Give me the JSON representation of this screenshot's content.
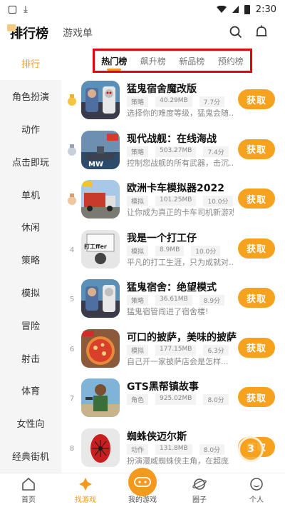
{
  "status": {
    "time": "2:30"
  },
  "header": {
    "title": "排行榜",
    "sub": "游戏单"
  },
  "sidebar": {
    "items": [
      {
        "label": "排行"
      },
      {
        "label": "角色扮演"
      },
      {
        "label": "动作"
      },
      {
        "label": "点击即玩"
      },
      {
        "label": "单机"
      },
      {
        "label": "休闲"
      },
      {
        "label": "策略"
      },
      {
        "label": "模拟"
      },
      {
        "label": "冒险"
      },
      {
        "label": "射击"
      },
      {
        "label": "体育"
      },
      {
        "label": "女性向"
      },
      {
        "label": "经典街机"
      }
    ]
  },
  "tabs": [
    {
      "label": "热门榜"
    },
    {
      "label": "飙升榜"
    },
    {
      "label": "新品榜"
    },
    {
      "label": "预约榜"
    }
  ],
  "games": [
    {
      "rank": "1",
      "name": "猛鬼宿舍魔改版",
      "genre": "策略",
      "size": "40.29MB",
      "score": "7.7分",
      "desc": "选择你的难度等级，猛鬼会随..."
    },
    {
      "rank": "2",
      "name": "现代战舰：在线海战",
      "genre": "策略",
      "size": "503.27MB",
      "score": "7.4分",
      "desc": "控制您战舰的所有武器，击沉..."
    },
    {
      "rank": "3",
      "name": "欧洲卡车模拟器2022",
      "genre": "模拟",
      "size": "101.25MB",
      "score": "10.0分",
      "desc": "让你成为真正的卡车司机新游戏"
    },
    {
      "rank": "4",
      "name": "我是一个打工仔",
      "genre": "模拟",
      "size": "8.9MB",
      "score": "10.0分",
      "desc": "平凡的打工生涯，只为成就对..."
    },
    {
      "rank": "5",
      "name": "猛鬼宿舍：绝望模式",
      "genre": "策略",
      "size": "36.61MB",
      "score": "8.9分",
      "desc": "猛鬼宿管闯进了宿舍楼!"
    },
    {
      "rank": "6",
      "name": "可口的披萨，美味的披萨",
      "genre": "模拟",
      "size": "177.15MB",
      "score": "6.3分",
      "desc": "自己开一家披萨店会是怎样..."
    },
    {
      "rank": "7",
      "name": "GTS黑帮镇故事",
      "genre": "角色",
      "size": "925.02MB",
      "score": "8.0分",
      "desc": ""
    },
    {
      "rank": "8",
      "name": "蜘蛛侠迈尔斯",
      "genre": "动作",
      "size": "131.8MB",
      "score": "8.0分",
      "desc": "扮演漫威蜘蛛侠主角，在超庞"
    }
  ],
  "get_label": "获取",
  "nav": [
    {
      "label": "首页"
    },
    {
      "label": "找游戏"
    },
    {
      "label": "我的游戏"
    },
    {
      "label": "圈子"
    },
    {
      "label": "个人"
    }
  ],
  "float_label": "3",
  "colors": {
    "accent": "#f39a1e",
    "button": "#f7a21e",
    "highlight_box": "#e3000f"
  }
}
